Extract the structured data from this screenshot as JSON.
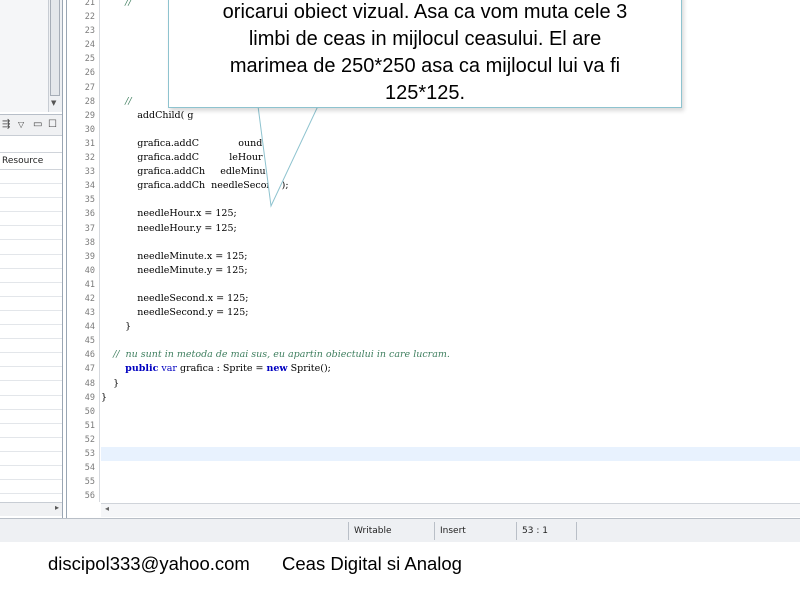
{
  "left_panel": {
    "column_header": "Resource"
  },
  "editor": {
    "line_numbers": [
      "21",
      "22",
      "23",
      "24",
      "25",
      "26",
      "27",
      "28",
      "29",
      "30",
      "31",
      "32",
      "33",
      "34",
      "35",
      "36",
      "37",
      "38",
      "39",
      "40",
      "41",
      "42",
      "43",
      "44",
      "45",
      "46",
      "47",
      "48",
      "49",
      "50",
      "51",
      "52",
      "53",
      "54",
      "55",
      "56"
    ],
    "code_lines": [
      {
        "indent": "        ",
        "segments": [
          {
            "t": "//",
            "c": "cmt"
          }
        ]
      },
      {
        "indent": "",
        "segments": []
      },
      {
        "indent": "",
        "segments": []
      },
      {
        "indent": "",
        "segments": []
      },
      {
        "indent": "",
        "segments": []
      },
      {
        "indent": "",
        "segments": []
      },
      {
        "indent": "",
        "segments": []
      },
      {
        "indent": "        ",
        "segments": [
          {
            "t": "//",
            "c": "cmt"
          }
        ]
      },
      {
        "indent": "            ",
        "segments": [
          {
            "t": "addChild( g",
            "c": ""
          }
        ]
      },
      {
        "indent": "",
        "segments": []
      },
      {
        "indent": "            ",
        "segments": [
          {
            "t": "grafica.addC",
            "c": ""
          },
          {
            "t": "             ",
            "c": ""
          },
          {
            "t": "ound );",
            "c": ""
          }
        ]
      },
      {
        "indent": "            ",
        "segments": [
          {
            "t": "grafica.addC",
            "c": ""
          },
          {
            "t": "          ",
            "c": ""
          },
          {
            "t": "leHour );",
            "c": ""
          }
        ]
      },
      {
        "indent": "            ",
        "segments": [
          {
            "t": "grafica.addCh",
            "c": ""
          },
          {
            "t": "     ",
            "c": ""
          },
          {
            "t": "edleMinute );",
            "c": ""
          }
        ]
      },
      {
        "indent": "            ",
        "segments": [
          {
            "t": "grafica.addCh",
            "c": ""
          },
          {
            "t": "  ",
            "c": ""
          },
          {
            "t": "needleSecond );",
            "c": ""
          }
        ]
      },
      {
        "indent": "",
        "segments": []
      },
      {
        "indent": "            ",
        "segments": [
          {
            "t": "needleHour.x = 125;",
            "c": ""
          }
        ]
      },
      {
        "indent": "            ",
        "segments": [
          {
            "t": "needleHour.y = 125;",
            "c": ""
          }
        ]
      },
      {
        "indent": "",
        "segments": []
      },
      {
        "indent": "            ",
        "segments": [
          {
            "t": "needleMinute.x = 125;",
            "c": ""
          }
        ]
      },
      {
        "indent": "            ",
        "segments": [
          {
            "t": "needleMinute.y = 125;",
            "c": ""
          }
        ]
      },
      {
        "indent": "",
        "segments": []
      },
      {
        "indent": "            ",
        "segments": [
          {
            "t": "needleSecond.x = 125;",
            "c": ""
          }
        ]
      },
      {
        "indent": "            ",
        "segments": [
          {
            "t": "needleSecond.y = 125;",
            "c": ""
          }
        ]
      },
      {
        "indent": "        ",
        "segments": [
          {
            "t": "}",
            "c": ""
          }
        ]
      },
      {
        "indent": "",
        "segments": []
      },
      {
        "indent": "    ",
        "segments": [
          {
            "t": "//  nu sunt in metoda de mai sus, eu apartin obiectului in care lucram.",
            "c": "cmt"
          }
        ]
      },
      {
        "indent": "        ",
        "segments": [
          {
            "t": "public",
            "c": "kw2b"
          },
          {
            "t": " ",
            "c": ""
          },
          {
            "t": "var",
            "c": "kw2"
          },
          {
            "t": " grafica : Sprite = ",
            "c": ""
          },
          {
            "t": "new",
            "c": "kw2b"
          },
          {
            "t": " Sprite();",
            "c": ""
          }
        ]
      },
      {
        "indent": "    ",
        "segments": [
          {
            "t": "}",
            "c": ""
          }
        ]
      },
      {
        "indent": "",
        "segments": [
          {
            "t": "}",
            "c": ""
          }
        ]
      },
      {
        "indent": "",
        "segments": []
      },
      {
        "indent": "",
        "segments": []
      },
      {
        "indent": "",
        "segments": []
      },
      {
        "indent": "",
        "segments": [],
        "current": true
      },
      {
        "indent": "",
        "segments": []
      },
      {
        "indent": "",
        "segments": []
      },
      {
        "indent": "",
        "segments": []
      }
    ]
  },
  "statusbar": {
    "mode": "Writable",
    "insert": "Insert",
    "position": "53 : 1"
  },
  "callout": {
    "lines": [
      "oricarui obiect vizual. Asa ca vom muta cele 3",
      "limbi de ceas in mijlocul ceasului. El are",
      "marimea de 250*250 asa ca mijlocul lui va fi",
      "125*125."
    ]
  },
  "footer": {
    "email": "discipol333@yahoo.com",
    "title": "Ceas Digital si Analog"
  },
  "colors": {
    "keyword": "#0000c0",
    "comment": "#3f7f5f",
    "current_line": "#e8f2fe",
    "callout_border": "#8ec3cf"
  }
}
